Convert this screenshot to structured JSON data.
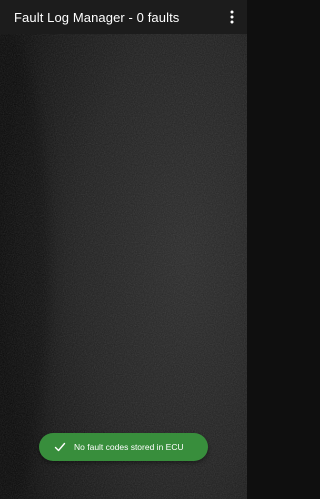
{
  "app_bar": {
    "title": "Fault Log Manager - 0 faults",
    "overflow_icon": "more-vert-icon"
  },
  "snackbar": {
    "icon": "check-icon",
    "message": "No fault codes stored in ECU",
    "color": "#388e3c"
  }
}
